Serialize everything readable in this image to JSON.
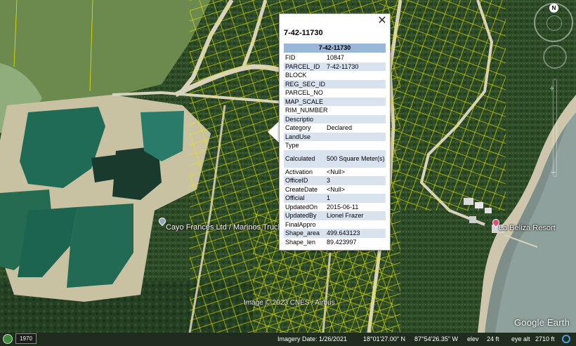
{
  "map": {
    "labels": {
      "cayo": "Cayo Frances Ltd / Marinos Trucki",
      "resort": "La Beliza Resort"
    },
    "colors": {
      "parcel_lines": "#e8e400",
      "water": "#1f6b55",
      "resort_pin": "#e84a7a",
      "poi_pin": "#9aa6b5"
    }
  },
  "balloon": {
    "close": "✕",
    "title": "7-42-11730",
    "table_header": "7-42-11730",
    "rows": [
      {
        "key": "FID",
        "value": "10847"
      },
      {
        "key": "PARCEL_ID",
        "value": "7-42-11730"
      },
      {
        "key": "BLOCK",
        "value": ""
      },
      {
        "key": "REG_SEC_ID",
        "value": ""
      },
      {
        "key": "PARCEL_NO",
        "value": ""
      },
      {
        "key": "MAP_SCALE",
        "value": ""
      },
      {
        "key": "RIM_NUMBER",
        "value": ""
      },
      {
        "key": "Descriptio",
        "value": ""
      },
      {
        "key": "Category",
        "value": "Declared"
      },
      {
        "key": "LandUse",
        "value": ""
      },
      {
        "key": "Type",
        "value": ""
      },
      {
        "key": "Calculated",
        "value": "500 Square Meter(s)"
      },
      {
        "key": "Activation",
        "value": "<Null>"
      },
      {
        "key": "OfficeID",
        "value": "3"
      },
      {
        "key": "CreateDate",
        "value": "<Null>"
      },
      {
        "key": "Official",
        "value": "1"
      },
      {
        "key": "UpdatedOn",
        "value": "2015-06-11"
      },
      {
        "key": "UpdatedBy",
        "value": "Lionel Frazer"
      },
      {
        "key": "FinalAppro",
        "value": ""
      },
      {
        "key": "Shape_area",
        "value": "499.643123"
      },
      {
        "key": "Shape_len",
        "value": "89.423997"
      }
    ]
  },
  "nav": {
    "north": "N"
  },
  "watermark": {
    "copyright": "Image © 2023 CNES / Airbus",
    "logo": "Google Earth"
  },
  "status": {
    "year": "1970",
    "imagery_date": "Imagery Date: 1/26/2021",
    "lat": "18°01'27.00\" N",
    "lon": "87°54'26.35\" W",
    "elev_label": "elev",
    "elev": "24 ft",
    "eye_label": "eye alt",
    "eye_alt": "2710 ft"
  }
}
